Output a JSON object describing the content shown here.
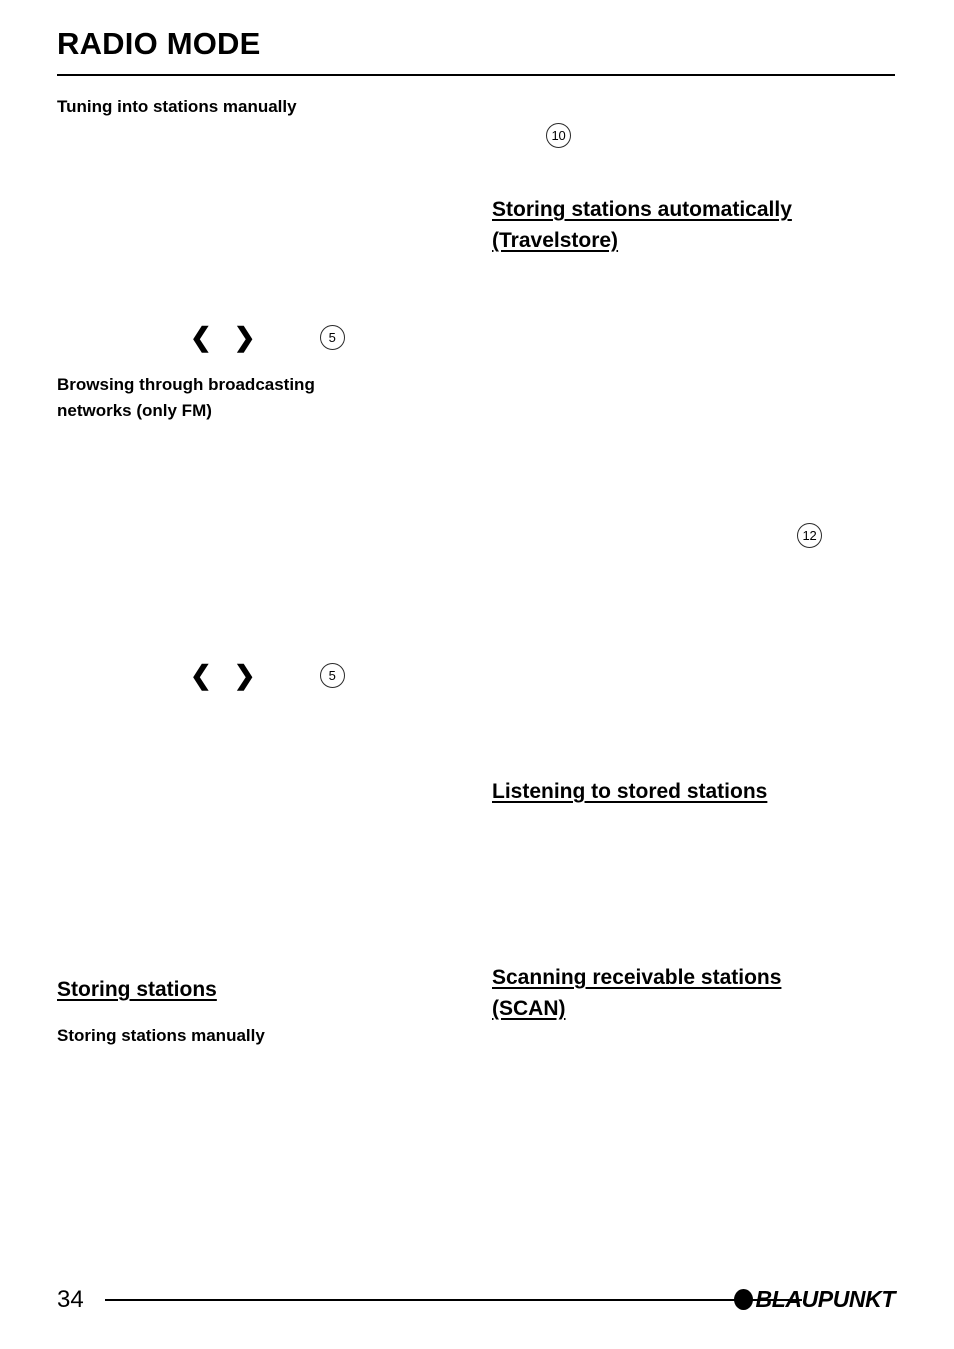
{
  "document": {
    "title": "RADIO MODE",
    "page_number": "34",
    "brand": "BLAUPUNKT",
    "brand_dot_icon": "filled-circle-icon"
  },
  "left_column": {
    "heading_tuning_manually": "Tuning into stations manually",
    "heading_browsing_networks": "Browsing through broadcasting\nnetworks (only FM)",
    "heading_storing_stations": "Storing stations",
    "heading_storing_manually": "Storing stations manually",
    "step_markers": [
      {
        "left_arrow": "❮",
        "right_arrow": "❯",
        "callout": "5"
      },
      {
        "left_arrow": "❮",
        "right_arrow": "❯",
        "callout": "5"
      }
    ]
  },
  "right_column": {
    "heading_travelstore": "Storing stations automatically\n(Travelstore)",
    "heading_listening_stored": "Listening to stored stations",
    "heading_scan": "Scanning receivable stations\n(SCAN)",
    "callouts": [
      {
        "label": "10"
      },
      {
        "label": "12"
      }
    ]
  }
}
